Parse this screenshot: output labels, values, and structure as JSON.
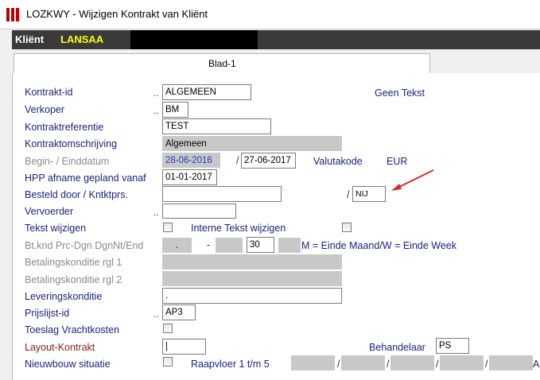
{
  "window": {
    "title": "LOZKWY - Wijzigen Kontrakt van Kliënt"
  },
  "client": {
    "label": "Kliënt",
    "value": "LANSAA"
  },
  "tabs": [
    {
      "label": "Blad-1"
    }
  ],
  "form": {
    "kontrakt_id": {
      "label": "Kontrakt-id",
      "dots": "..",
      "value": "ALGEMEEN",
      "note": "Geen Tekst"
    },
    "verkoper": {
      "label": "Verkoper",
      "dots": "..",
      "value": "BM"
    },
    "kontraktreferentie": {
      "label": "Kontraktreferentie",
      "value": "TEST"
    },
    "kontraktomschrijving": {
      "label": "Kontraktomschrijving",
      "value": "Algemeen"
    },
    "begin_eind": {
      "label": "Begin- / Einddatum",
      "begin": "28-06-2016",
      "sep": "/",
      "eind": "27-06-2017",
      "valuta_label": "Valutakode",
      "valuta_value": "EUR"
    },
    "hpp": {
      "label": "HPP afname gepland vanaf",
      "value": "01-01-2017"
    },
    "besteld": {
      "label": "Besteld door / Kntktprs.",
      "value": "",
      "sep": "/",
      "kntktprs": "NIJ"
    },
    "vervoerder": {
      "label": "Vervoerder",
      "dots": "..",
      "value": ""
    },
    "tekst_wijzigen": {
      "label": "Tekst wijzigen",
      "interne_label": "Interne Tekst wijzigen"
    },
    "btknd": {
      "label": "Bt.knd Prc-Dgn DgnNt/End",
      "v1": ".",
      "dash": "-",
      "v3": "30",
      "note": "M = Einde Maand/W = Einde Week"
    },
    "betaling1": {
      "label": "Betalingskonditie rgl 1",
      "value": ""
    },
    "betaling2": {
      "label": "Betalingskonditie rgl 2",
      "value": ""
    },
    "levering": {
      "label": "Leveringskonditie",
      "value": "."
    },
    "prijslijst": {
      "label": "Prijslijst-id",
      "dots": "..",
      "value": "AP3"
    },
    "toeslag": {
      "label": "Toeslag Vrachtkosten"
    },
    "layout": {
      "label": "Layout-Kontrakt",
      "value": "|",
      "behandelaar_label": "Behandelaar",
      "behandelaar_value": "PS"
    },
    "nieuwbouw": {
      "label": "Nieuwbouw situatie",
      "raapvloer_label": "Raapvloer 1 t/m 5",
      "sep": "/",
      "tail": "A"
    }
  },
  "colors": {
    "label_blue": "#1a237e",
    "client_yellow": "#ffff00",
    "client_bar": "#3a3a3a",
    "arrow_red": "#d32f2f"
  }
}
